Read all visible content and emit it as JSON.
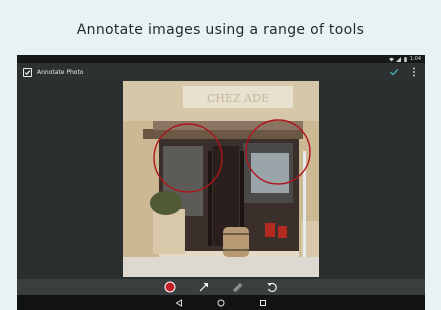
{
  "headline": "Annotate images using a range of tools",
  "status_bar": {
    "time": "1:04"
  },
  "app_bar": {
    "title": "Annotate Photo"
  },
  "icons": {
    "app": "checkbox-icon",
    "confirm": "check-icon",
    "menu": "overflow-menu-icon",
    "color": "color-dot-icon",
    "arrow": "arrow-tool-icon",
    "pen": "highlighter-tool-icon",
    "undo": "undo-icon",
    "back": "back-icon",
    "home": "home-icon",
    "recents": "recents-icon"
  },
  "photo_text": "CHEZ  ADE",
  "colors": {
    "accent": "#3fb5ae",
    "annotation": "#b0151d",
    "selected_color": "#c21f26"
  }
}
